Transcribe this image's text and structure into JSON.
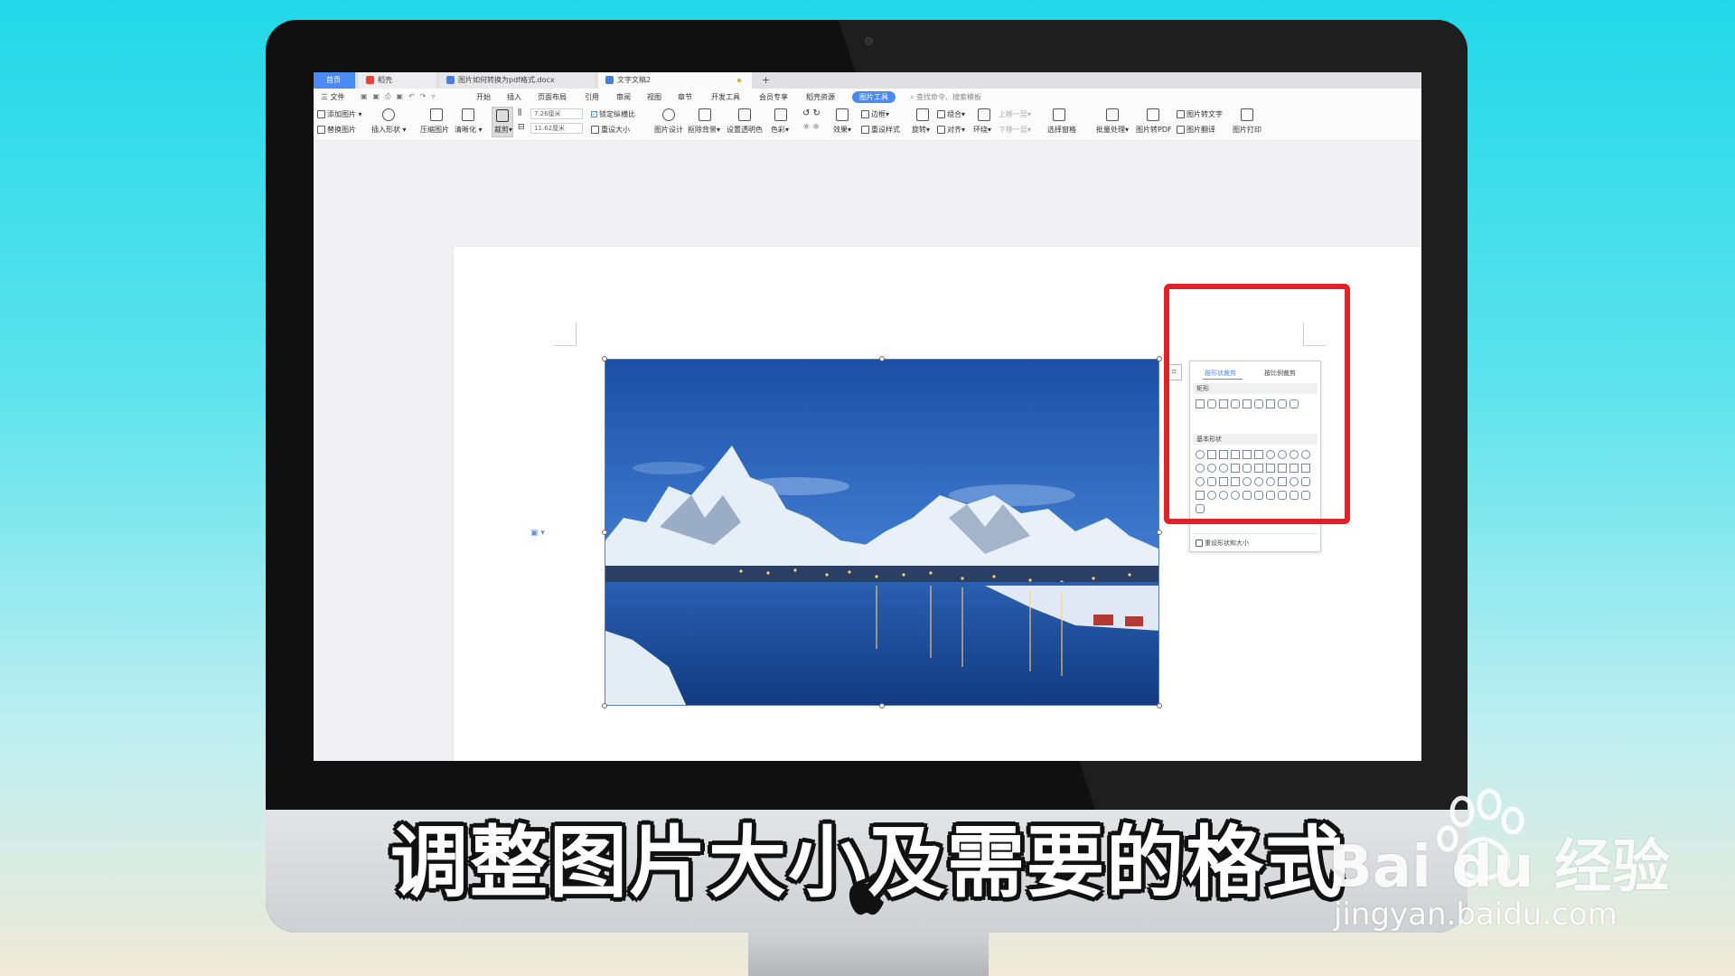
{
  "tabs": {
    "home": "首页",
    "daoke": "稻壳",
    "doc1": "图片如何转换为pdf格式.docx",
    "doc2": "文字文稿2",
    "add": "+"
  },
  "menu": {
    "file": "三 文件",
    "items": [
      "开始",
      "插入",
      "页面布局",
      "引用",
      "审阅",
      "视图",
      "章节",
      "开发工具",
      "会员专享",
      "稻壳资源"
    ],
    "active": "图片工具",
    "search": "查找命令、搜索模板"
  },
  "toolbar": {
    "add_picture": "添加图片",
    "replace_picture": "替换图片",
    "insert_shape": "插入形状",
    "compress": "压缩图片",
    "clarify": "清晰化",
    "crop": "裁剪",
    "height": "7.26厘米",
    "width": "11.62厘米",
    "lock_ratio": "锁定纵横比",
    "reset_size": "重设大小",
    "pic_design": "图片设计",
    "remove_bg": "抠除背景",
    "set_transparent": "设置透明色",
    "color": "色彩",
    "effect": "效果",
    "reset_style": "重设样式",
    "border": "边框",
    "rotate": "旋转",
    "group": "组合",
    "align": "对齐",
    "wrap": "环绕",
    "bring_up": "上移一层",
    "send_down": "下移一层",
    "select_pane": "选择窗格",
    "batch": "批量处理",
    "to_pdf": "图片转PDF",
    "to_text": "图片转文字",
    "translate": "图片翻译",
    "print": "图片打印"
  },
  "crop_panel": {
    "tab_shape": "按形状裁剪",
    "tab_ratio": "按比例裁剪",
    "section_rect": "矩形",
    "section_basic": "基本形状",
    "reset": "重设形状和大小"
  },
  "caption": "调整图片大小及需要的格式",
  "watermark": {
    "brand": "Bai du 经验",
    "url": "jingyan.baidu.com"
  },
  "colors": {
    "accent": "#4a8af4",
    "highlight": "#e2202a"
  }
}
